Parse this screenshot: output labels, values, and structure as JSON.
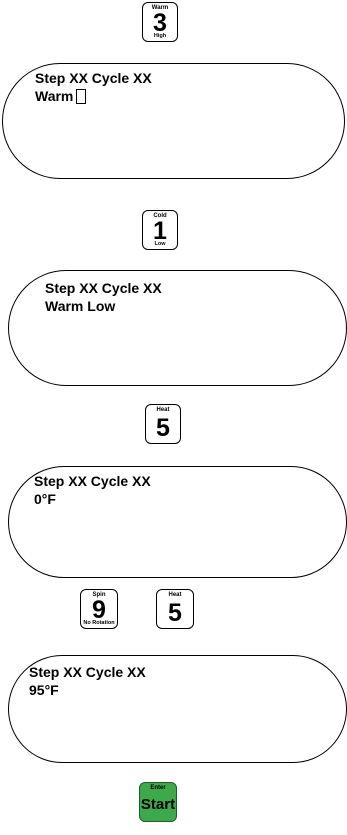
{
  "keys": {
    "k1": {
      "top": "Warm",
      "main": "3",
      "bottom": "High"
    },
    "k2": {
      "top": "Cold",
      "main": "1",
      "bottom": "Low"
    },
    "k3": {
      "top": "Heat",
      "main": "5",
      "bottom": ""
    },
    "k4": {
      "top": "Spin",
      "main": "9",
      "bottom": "No Rotation"
    },
    "k5": {
      "top": "Heat",
      "main": "5",
      "bottom": ""
    },
    "start": {
      "top": "Enter",
      "main": "Start",
      "bottom": ""
    }
  },
  "displays": {
    "d1": {
      "line1": "Step XX Cycle XX",
      "line2": "Warm"
    },
    "d2": {
      "line1": "Step XX Cycle XX",
      "line2": "Warm Low"
    },
    "d3": {
      "line1": "Step XX Cycle XX",
      "line2": "0°F"
    },
    "d4": {
      "line1": "Step XX Cycle XX",
      "line2": "95°F"
    }
  },
  "colors": {
    "start_key": "#3da94a"
  }
}
